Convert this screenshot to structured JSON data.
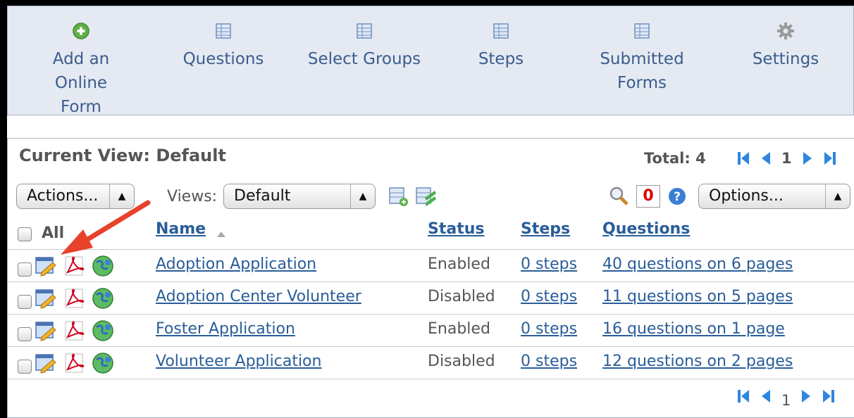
{
  "toolbar": {
    "items": [
      {
        "label": "Add an Online\nForm",
        "icon": "add-icon"
      },
      {
        "label": "Questions",
        "icon": "table-icon"
      },
      {
        "label": "Select Groups",
        "icon": "table-icon"
      },
      {
        "label": "Steps",
        "icon": "table-icon"
      },
      {
        "label": "Submitted\nForms",
        "icon": "table-icon"
      },
      {
        "label": "Settings",
        "icon": "gear-icon"
      }
    ]
  },
  "view": {
    "title": "Current View: Default",
    "total": "Total: 4",
    "page": "1",
    "actions_label": "Actions...",
    "views_label": "Views:",
    "views_selected": "Default",
    "options_label": "Options...",
    "filter_count": "0"
  },
  "table": {
    "all_label": "All",
    "headers": {
      "name": "Name",
      "status": "Status",
      "steps": "Steps",
      "questions": "Questions"
    },
    "rows": [
      {
        "name": "Adoption Application",
        "status": "Enabled",
        "steps": "0 steps",
        "questions": "40 questions on 6 pages"
      },
      {
        "name": "Adoption Center Volunteer",
        "status": "Disabled",
        "steps": "0 steps",
        "questions": "11 questions on 5 pages"
      },
      {
        "name": "Foster Application",
        "status": "Enabled",
        "steps": "0 steps",
        "questions": "16 questions on 1 page"
      },
      {
        "name": "Volunteer Application",
        "status": "Disabled",
        "steps": "0 steps",
        "questions": "12 questions on 2 pages"
      }
    ]
  },
  "footer": {
    "page": "1"
  },
  "colors": {
    "link": "#2a5d99",
    "toolbar_bg": "#e5e9f1",
    "annotation_arrow": "#e8412c",
    "filter_count": "#e00000"
  }
}
